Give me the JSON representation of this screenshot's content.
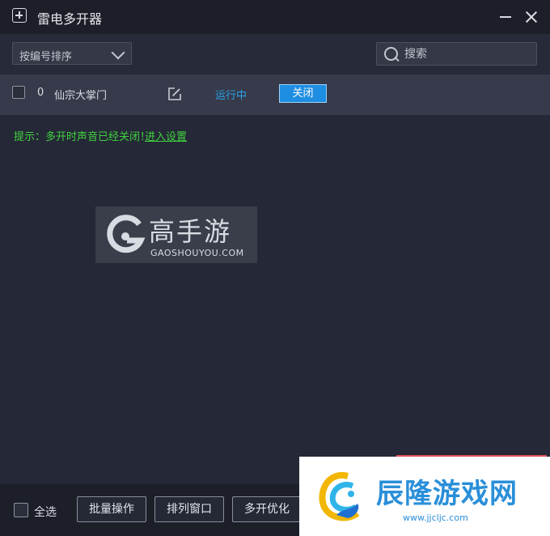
{
  "window": {
    "title": "雷电多开器",
    "icon": "plus-square-icon"
  },
  "toolbar": {
    "sort_label": "按编号排序",
    "search_placeholder": "搜索"
  },
  "instances": [
    {
      "index": "0",
      "name": "仙宗大掌门",
      "status": "运行中",
      "close_label": "关闭"
    }
  ],
  "notice": {
    "text": "提示：多开时声音已经关闭！",
    "link": "进入设置"
  },
  "bottom": {
    "select_all_label": "全选",
    "batch_label": "批量操作",
    "arrange_label": "排列窗口",
    "optimize_label": "多开优化"
  },
  "watermarks": {
    "primary_title": "高手游",
    "primary_domain": "GAOSHOUYOU.COM",
    "secondary_title": "辰隆游戏网",
    "secondary_url": "www.jjcljc.com"
  },
  "colors": {
    "status_running": "#2aa2e8",
    "notice_green": "#3fd33f",
    "close_button": "#1e8ee2",
    "watermark_blue": "#2a8fd9"
  }
}
